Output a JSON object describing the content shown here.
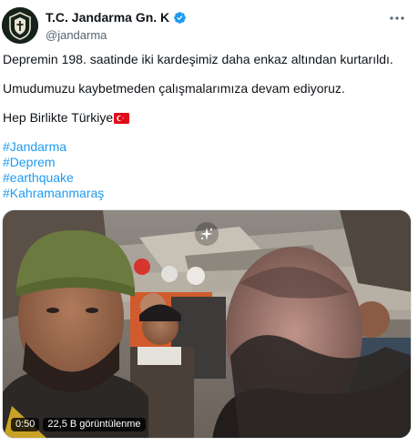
{
  "author": {
    "display_name": "T.C. Jandarma Gn. K",
    "handle": "@jandarma"
  },
  "tweet": {
    "paragraphs": [
      "Depremin 198. saatinde iki kardeşimiz daha enkaz altından kurtarıldı.",
      "Umudumuzu kaybetmeden çalışmalarımıza devam ediyoruz.",
      "Hep Birlikte Türkiye"
    ],
    "hashtags": [
      "#Jandarma",
      "#Deprem",
      "#earthquake",
      "#Kahramanmaraş"
    ]
  },
  "video": {
    "duration": "0:50",
    "views": "22,5 B görüntülenme"
  },
  "icons": {
    "verified": "verified-badge-icon",
    "more": "more-dots-icon",
    "flag": "turkish-flag-icon",
    "media-indicator": "sparkle-icon"
  },
  "colors": {
    "accent": "#1d9bf0",
    "text": "#0f1419",
    "secondary": "#536471"
  }
}
